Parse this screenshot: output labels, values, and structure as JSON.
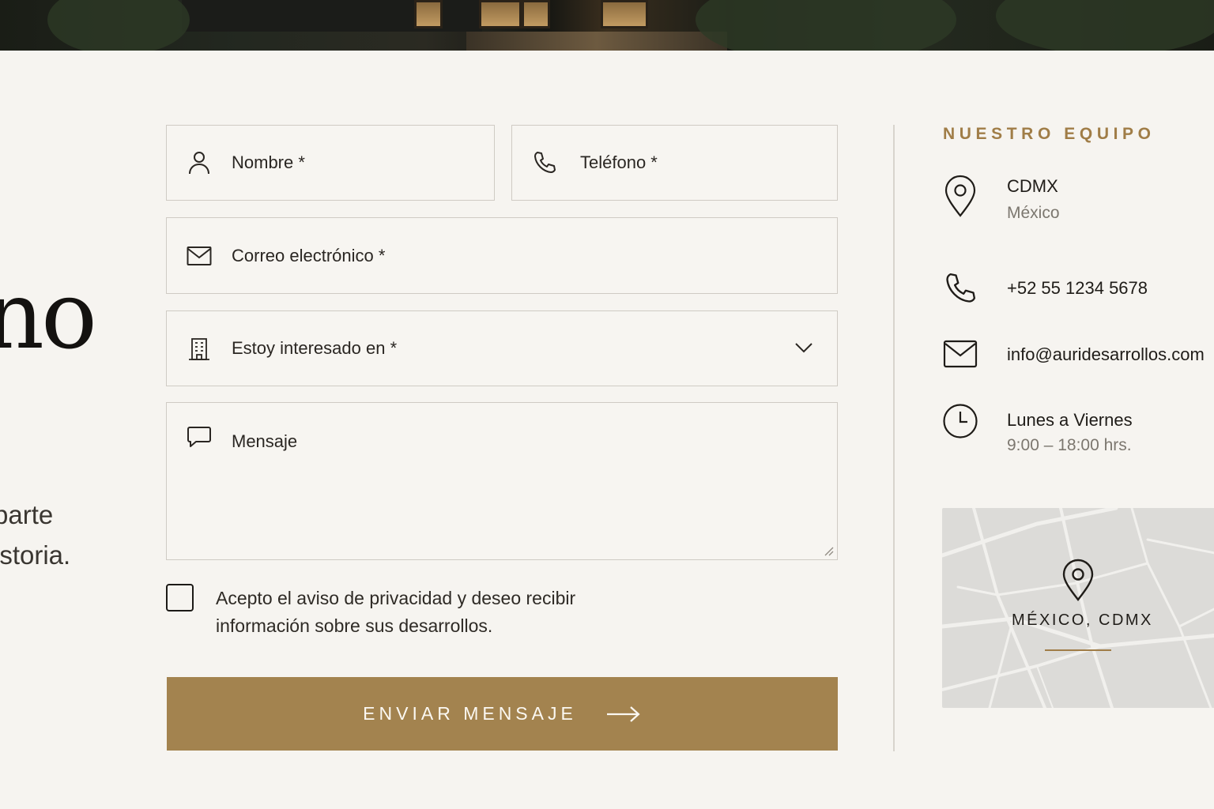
{
  "colors": {
    "accent": "#a3834f",
    "accent_text": "#a07d47",
    "background": "#f6f4f0",
    "field_border": "#cfcbc4"
  },
  "headline": {
    "fragment": "no"
  },
  "lead": {
    "line1": "parte",
    "line2": "istoria."
  },
  "form": {
    "name_placeholder": "Nombre *",
    "phone_placeholder": "Teléfono *",
    "email_placeholder": "Correo electrónico *",
    "interest_placeholder": "Estoy interesado en *",
    "message_placeholder": "Mensaje",
    "consent_text": "Acepto el aviso de privacidad y deseo recibir información sobre sus desarrollos.",
    "consent_checked": false,
    "submit_label": "ENVIAR MENSAJE",
    "icons": {
      "name": "user-icon",
      "phone": "phone-icon",
      "email": "mail-icon",
      "interest": "building-icon",
      "message": "chat-bubble-icon",
      "dropdown": "chevron-down-icon",
      "submit": "arrow-right-icon"
    }
  },
  "team": {
    "title": "NUESTRO EQUIPO",
    "location_city": "CDMX",
    "location_country": "México",
    "phone": "+52 55 1234 5678",
    "email": "info@auridesarrollos.com",
    "hours_days": "Lunes a Viernes",
    "hours_time": "9:00 – 18:00 hrs.",
    "icons": {
      "location": "map-pin-icon",
      "phone": "phone-icon",
      "email": "mail-icon",
      "hours": "clock-icon"
    }
  },
  "map": {
    "label": "MÉXICO, CDMX",
    "icon": "map-pin-icon"
  }
}
